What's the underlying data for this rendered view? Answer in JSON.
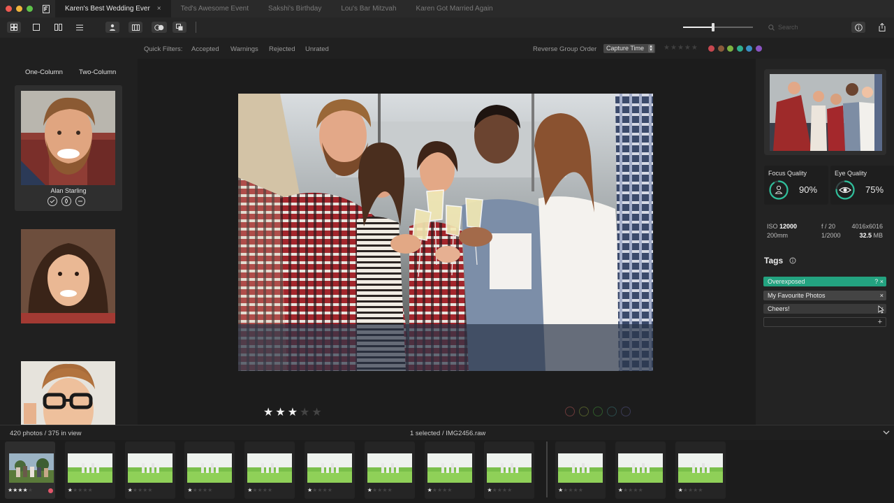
{
  "titlebar": {
    "tabs": [
      {
        "label": "Karen's Best Wedding Ever",
        "active": true
      },
      {
        "label": "Ted's Awesome Event",
        "active": false
      },
      {
        "label": "Sakshi's Birthday",
        "active": false
      },
      {
        "label": "Lou's Bar Mitzvah",
        "active": false
      },
      {
        "label": "Karen Got Married Again",
        "active": false
      }
    ],
    "close_glyph": "×"
  },
  "toolbar": {
    "search_placeholder": "Search",
    "icons": [
      "grid-view-icon",
      "single-view-icon",
      "compare-view-icon",
      "list-view-icon",
      "person-icon",
      "sidebar-icon",
      "overlay-icon",
      "layers-icon",
      "info-icon",
      "share-icon"
    ]
  },
  "filters": {
    "label": "Quick Filters:",
    "items": [
      "Accepted",
      "Warnings",
      "Rejected",
      "Unrated"
    ],
    "reverse_label": "Reverse Group Order",
    "sort_value": "Capture Time",
    "color_labels": [
      "#c6474f",
      "#8a5a3a",
      "#7cb342",
      "#2fae8f",
      "#3a8fc4",
      "#8a54c2"
    ]
  },
  "left_panel": {
    "one_column": "One-Column",
    "two_column": "Two-Column",
    "faces": [
      {
        "name": "Alan Starling",
        "selected": true
      },
      {
        "name": "",
        "selected": false
      },
      {
        "name": "",
        "selected": false
      }
    ]
  },
  "viewer": {
    "rating": 3,
    "max_rating": 5,
    "star_glyph": "★",
    "color_circles": [
      "#6b3a3a",
      "#4f5a2a",
      "#2f5a2a",
      "#2a4a4a",
      "#3a3a55"
    ]
  },
  "right_panel": {
    "focus_quality": {
      "title": "Focus Quality",
      "value": "90%",
      "fraction": 0.9
    },
    "eye_quality": {
      "title": "Eye Quality",
      "value": "75%",
      "fraction": 0.75
    },
    "meta": {
      "iso_label": "ISO",
      "iso": "12000",
      "aperture": "f / 20",
      "dimensions": "4016x6016",
      "focal": "200mm",
      "shutter": "1/2000",
      "size_value": "32.5",
      "size_unit": "MB"
    },
    "tags_title": "Tags",
    "tags": [
      {
        "label": "Overexposed",
        "suffix": "? ×",
        "color": "#23a380"
      },
      {
        "label": "My Favourite Photos",
        "suffix": "×",
        "color": "#444444"
      },
      {
        "label": "Cheers!",
        "suffix": "×",
        "color": "#3a3a3a"
      }
    ],
    "add_glyph": "+"
  },
  "status": {
    "count": "420 photos / 375 in view",
    "selection": "1 selected / IMG2456.raw"
  },
  "filmstrip": {
    "items": [
      {
        "rating": 4,
        "selected": true,
        "label_color": "#e2566a"
      },
      {
        "rating": 1
      },
      {
        "rating": 1
      },
      {
        "rating": 1
      },
      {
        "rating": 1
      },
      {
        "rating": 1
      },
      {
        "rating": 1
      },
      {
        "rating": 1
      },
      {
        "rating": 1
      },
      {
        "rating": 1
      },
      {
        "rating": 1
      },
      {
        "rating": 1
      }
    ]
  }
}
